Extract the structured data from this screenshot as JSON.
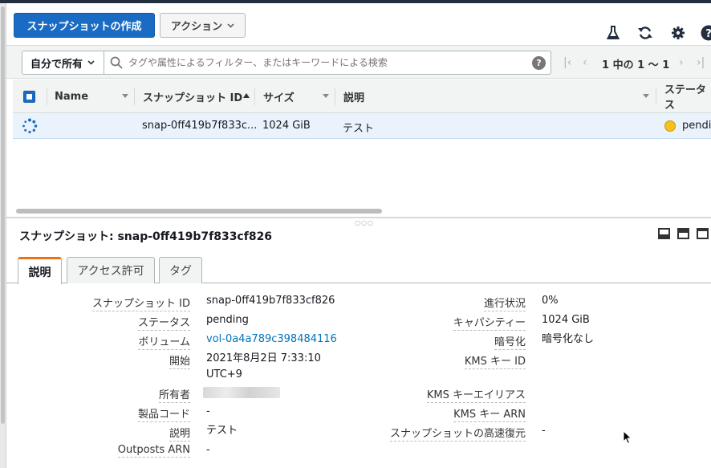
{
  "toolbar": {
    "create_label": "スナップショットの作成",
    "actions_label": "アクション"
  },
  "filter": {
    "owner": "自分で所有",
    "search_placeholder": "タグや属性によるフィルター、またはキーワードによる検索",
    "pagination": "1 中の 1 〜 1"
  },
  "table": {
    "columns": [
      "Name",
      "スナップショット ID",
      "サイズ",
      "説明",
      "ステータス"
    ],
    "rows": [
      {
        "name": "",
        "snapshot_id": "snap-0ff419b7f833c...",
        "size": "1024 GiB",
        "description": "テスト",
        "status": "pendir"
      }
    ]
  },
  "detail": {
    "title": "スナップショット: snap-0ff419b7f833cf826",
    "tabs": [
      "説明",
      "アクセス許可",
      "タグ"
    ],
    "left": [
      {
        "label": "スナップショット ID",
        "value": "snap-0ff419b7f833cf826"
      },
      {
        "label": "ステータス",
        "value": "pending"
      },
      {
        "label": "ボリューム",
        "value": "vol-0a4a789c398484116"
      },
      {
        "label": "開始",
        "value": "2021年8月2日 7:33:10",
        "value2": "UTC+9"
      },
      {
        "label": "所有者",
        "value": ""
      },
      {
        "label": "製品コード",
        "value": "-"
      },
      {
        "label": "説明",
        "value": "テスト"
      },
      {
        "label": "Outposts ARN",
        "value": "-"
      }
    ],
    "right": [
      {
        "label": "進行状況",
        "value": "0%"
      },
      {
        "label": "キャパシティー",
        "value": "1024 GiB"
      },
      {
        "label": "暗号化",
        "value": "暗号化なし"
      },
      {
        "label": "KMS キー ID",
        "value": ""
      },
      {
        "label": "KMS キーエイリアス",
        "value": ""
      },
      {
        "label": "KMS キー ARN",
        "value": ""
      },
      {
        "label": "スナップショットの高速復元",
        "value": "-"
      }
    ]
  },
  "colors": {
    "primary": "#1a6bc4",
    "link": "#0073bb",
    "tab_accent": "#ec7211",
    "pending": "#f6c21b"
  }
}
